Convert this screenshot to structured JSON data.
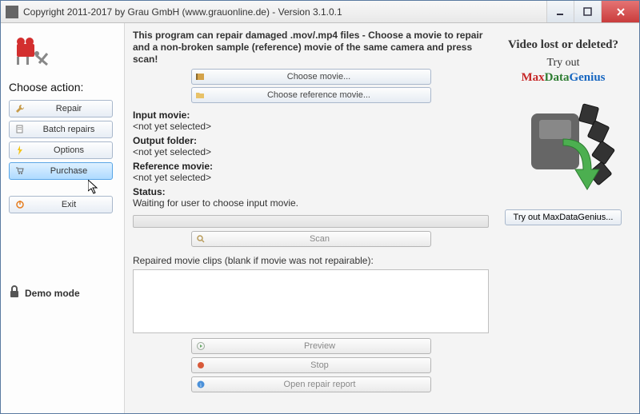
{
  "window": {
    "title": "Copyright 2011-2017 by Grau GmbH (www.grauonline.de) - Version 3.1.0.1"
  },
  "sidebar": {
    "heading": "Choose action:",
    "buttons": {
      "repair": "Repair",
      "batch": "Batch repairs",
      "options": "Options",
      "purchase": "Purchase",
      "exit": "Exit"
    },
    "demo": "Demo mode"
  },
  "main": {
    "intro": "This program can repair damaged .mov/.mp4 files - Choose a movie to repair and a non-broken sample (reference) movie of the same camera and press scan!",
    "choose_movie": "Choose movie...",
    "choose_reference": "Choose reference movie...",
    "input_label": "Input movie:",
    "input_value": "<not yet selected>",
    "output_label": "Output folder:",
    "output_value": "<not yet selected>",
    "reference_label": "Reference movie:",
    "reference_value": "<not yet selected>",
    "status_label": "Status:",
    "status_value": "Waiting for user to choose input movie.",
    "scan": "Scan",
    "repaired_label": "Repaired movie clips (blank if movie was not repairable):",
    "preview": "Preview",
    "stop": "Stop",
    "open_report": "Open repair report"
  },
  "promo": {
    "title": "Video lost or deleted?",
    "sub": "Try out",
    "brand_m": "Max",
    "brand_d": "Data",
    "brand_g": "Genius",
    "try_button": "Try out MaxDataGenius..."
  }
}
